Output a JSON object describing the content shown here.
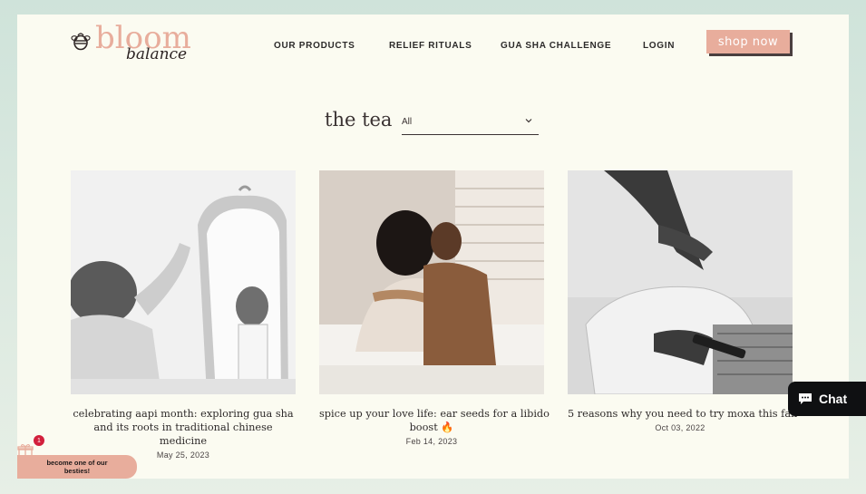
{
  "header": {
    "logo_word_top": "bloom",
    "logo_word_bottom": "balance",
    "nav": [
      "OUR PRODUCTS",
      "RELIEF RITUALS",
      "GUA SHA CHALLENGE",
      "LOGIN"
    ],
    "shop_label": "shop now"
  },
  "blog": {
    "title": "the tea",
    "filter_value": "All"
  },
  "posts": [
    {
      "title_lines": [
        "celebrating aapi month: exploring gua sha",
        "and its roots in traditional chinese",
        "medicine"
      ],
      "date": "May 25, 2023"
    },
    {
      "title_lines": [
        "spice up your love life: ear seeds for a libido",
        "boost 🔥"
      ],
      "date": "Feb 14, 2023"
    },
    {
      "title_lines": [
        "5 reasons why you need to try moxa this fall"
      ],
      "date": "Oct 03, 2022"
    }
  ],
  "widgets": {
    "chat_label": "Chat",
    "gift_badge_count": "1",
    "bestie_line1": "become one of our",
    "bestie_line2": "besties!"
  },
  "colors": {
    "accent": "#e8ad9c",
    "page_bg": "#fbfbf1",
    "outer_bg": "#dbe9e0",
    "text_dark": "#2c2a2a"
  }
}
